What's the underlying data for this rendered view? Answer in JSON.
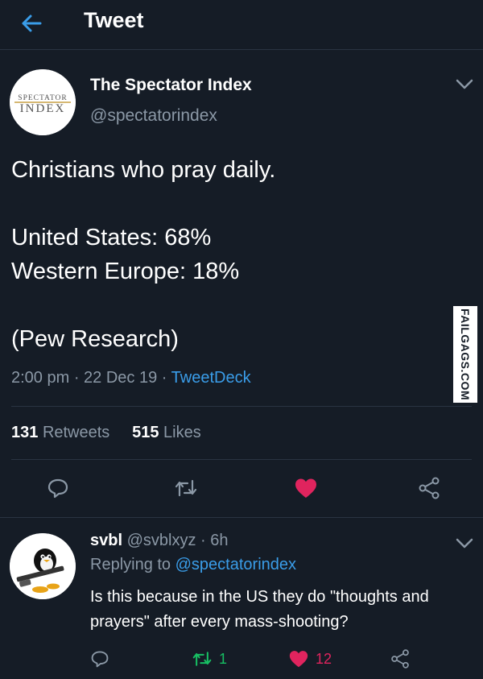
{
  "header": {
    "title": "Tweet",
    "back_icon": "arrow-left-icon"
  },
  "tweet": {
    "author_name": "The Spectator Index",
    "author_handle": "@spectatorindex",
    "avatar_logo_text": "SPECTATOR INDEX",
    "lines": [
      "Christians who pray daily.",
      "",
      "United States: 68%",
      "Western Europe: 18%",
      "",
      "(Pew Research)"
    ],
    "time": "2:00 pm",
    "date": "22 Dec 19",
    "client": "TweetDeck",
    "retweets_count": "131",
    "retweets_label": "Retweets",
    "likes_count": "515",
    "likes_label": "Likes"
  },
  "actions": {
    "reply_icon": "comment-icon",
    "retweet_icon": "retweet-icon",
    "like_icon": "heart-icon",
    "share_icon": "share-icon"
  },
  "reply": {
    "name": "svbl",
    "handle": "@svblxyz",
    "age": "6h",
    "replying_prefix": "Replying to",
    "replying_to": "@spectatorindex",
    "text": "Is this because in the US they do \"thoughts and prayers\" after every mass-shooting?",
    "retweet_count": "1",
    "like_count": "12"
  },
  "watermark": "FAILGAGS.COM",
  "colors": {
    "background": "#151c26",
    "accent_blue": "#3a9de9",
    "like_red": "#e0245e",
    "retweet_green": "#17bf63",
    "secondary_text": "#8b98a6"
  }
}
